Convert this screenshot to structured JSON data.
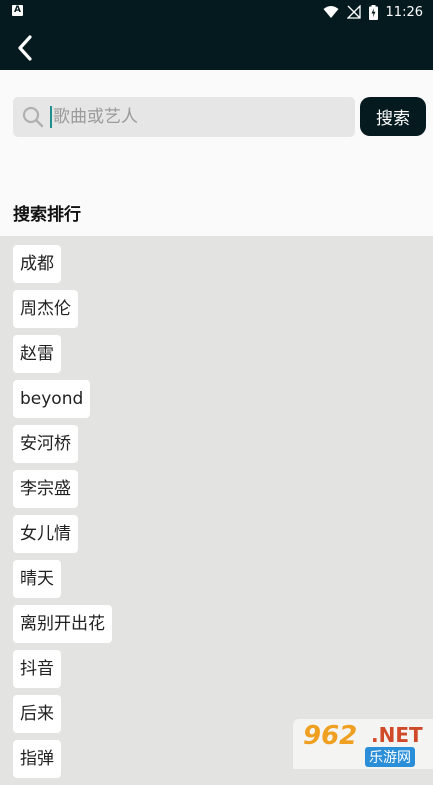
{
  "status_bar": {
    "time": "11:26",
    "notification_icon": "a-notification-icon"
  },
  "top_bar": {
    "back_icon": "chevron-left-icon"
  },
  "search": {
    "placeholder": "歌曲或艺人",
    "value": "",
    "button_label": "搜索"
  },
  "ranking": {
    "title": "搜索排行",
    "items": [
      "成都",
      "周杰伦",
      "赵雷",
      "beyond",
      "安河桥",
      "李宗盛",
      "女儿情",
      "晴天",
      "离别开出花",
      "抖音",
      "后来",
      "指弹"
    ]
  },
  "watermark": {
    "number": "962",
    "suffix": ".NET",
    "cn": "乐游网"
  },
  "colors": {
    "header_bg": "#051a1f",
    "page_bg": "#e3e3e1",
    "search_bg": "#fafafa",
    "caret": "#1e8e8e"
  }
}
